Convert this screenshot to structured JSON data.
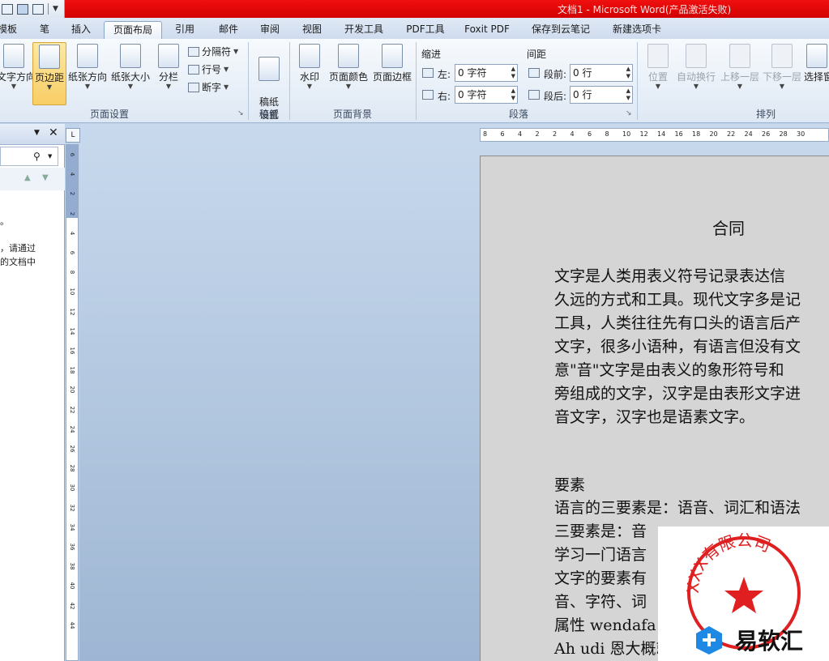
{
  "titlebar": {
    "title": "文档1 - Microsoft Word(产品激活失败)"
  },
  "tabs": [
    {
      "label": "模板"
    },
    {
      "label": "笔"
    },
    {
      "label": "插入"
    },
    {
      "label": "页面布局"
    },
    {
      "label": "引用"
    },
    {
      "label": "邮件"
    },
    {
      "label": "审阅"
    },
    {
      "label": "视图"
    },
    {
      "label": "开发工具"
    },
    {
      "label": "PDF工具"
    },
    {
      "label": "Foxit PDF"
    },
    {
      "label": "保存到云笔记"
    },
    {
      "label": "新建选项卡"
    }
  ],
  "ribbon": {
    "page_setup": {
      "text_direction": "文字方向",
      "margins": "页边距",
      "orientation": "纸张方向",
      "size": "纸张大小",
      "columns": "分栏",
      "breaks": "分隔符",
      "line_numbers": "行号",
      "hyphenation": "断字",
      "group_label": "页面设置"
    },
    "manuscript": {
      "settings": "稿纸\n设置",
      "group_label": "稿纸"
    },
    "page_background": {
      "watermark": "水印",
      "page_color": "页面颜色",
      "page_borders": "页面边框",
      "group_label": "页面背景"
    },
    "paragraph": {
      "indent_label": "缩进",
      "spacing_label": "间距",
      "left_label": "左:",
      "right_label": "右:",
      "before_label": "段前:",
      "after_label": "段后:",
      "left_value": "0 字符",
      "right_value": "0 字符",
      "before_value": "0 行",
      "after_value": "0 行",
      "group_label": "段落"
    },
    "arrange": {
      "position": "位置",
      "wrap": "自动换行",
      "bring_forward": "上移一层",
      "send_backward": "下移一层",
      "selection_pane": "选择窗",
      "group_label": "排列"
    }
  },
  "nav_pane": {
    "partial_text_1": "。",
    "partial_text_2": "，请通过",
    "partial_text_3": "的文档中"
  },
  "hruler_ticks": [
    "8",
    "6",
    "4",
    "2",
    "2",
    "4",
    "6",
    "8",
    "10",
    "12",
    "14",
    "16",
    "18",
    "20",
    "22",
    "24",
    "26",
    "28",
    "30"
  ],
  "vruler_ticks": [
    "6",
    "4",
    "2",
    "2",
    "4",
    "6",
    "8",
    "10",
    "12",
    "14",
    "16",
    "18",
    "20",
    "22",
    "24",
    "26",
    "28",
    "30",
    "32",
    "34",
    "36",
    "38",
    "40",
    "42",
    "44"
  ],
  "document": {
    "title": "合同",
    "para1": [
      "文字是人类用表义符号记录表达信",
      "久远的方式和工具。现代文字多是记",
      "工具，人类往往先有口头的语言后产",
      "文字，很多小语种，有语言但没有文",
      "意\"音\"文字是由表义的象形符号和",
      "旁组成的文字，汉字是由表形文字进",
      "音文字，汉字也是语素文字。"
    ],
    "section": "要素",
    "para2": [
      "语言的三要素是：语音、词汇和语法",
      "三要素是：音",
      "学习一门语言",
      "文字的要素有",
      "音、字符、词",
      "属性 wendafa",
      "Ah udi 恩大概就"
    ]
  },
  "watermark": {
    "stamp": "XXX有限公司",
    "brand": "易软汇"
  }
}
